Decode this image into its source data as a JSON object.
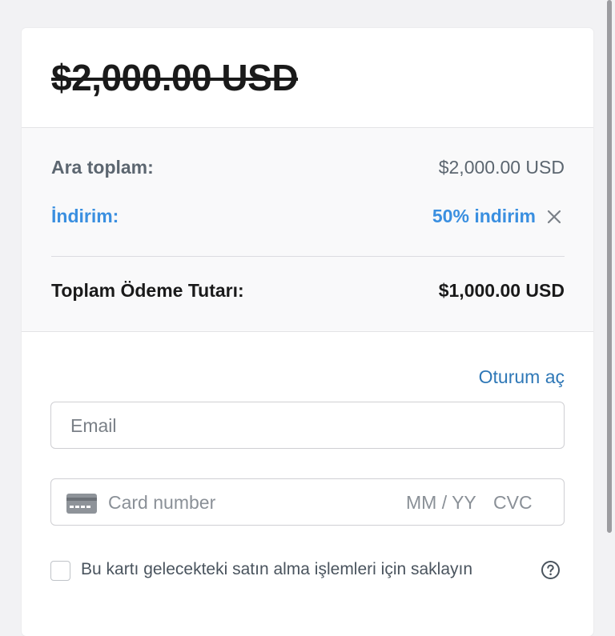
{
  "checkout": {
    "original_price": "$2,000.00 USD",
    "summary": {
      "subtotal_label": "Ara toplam:",
      "subtotal_value": "$2,000.00 USD",
      "discount_label": "İndirim:",
      "discount_value": "50% indirim",
      "total_label": "Toplam Ödeme Tutarı:",
      "total_value": "$1,000.00 USD"
    },
    "signin_link": "Oturum aç",
    "email": {
      "placeholder": "Email",
      "value": ""
    },
    "card": {
      "number_placeholder": "Card number",
      "expiry_placeholder": "MM / YY",
      "cvc_placeholder": "CVC",
      "icon": "credit-card-icon"
    },
    "save_card": {
      "label": "Bu kartı gelecekteki satın alma işlemleri için saklayın",
      "checked": false,
      "help_icon": "question-circle-icon"
    }
  },
  "colors": {
    "accent_blue": "#3a8fe0",
    "link_blue": "#2f78b7",
    "text_dark": "#1a1a1a",
    "text_muted": "#5c6670"
  }
}
